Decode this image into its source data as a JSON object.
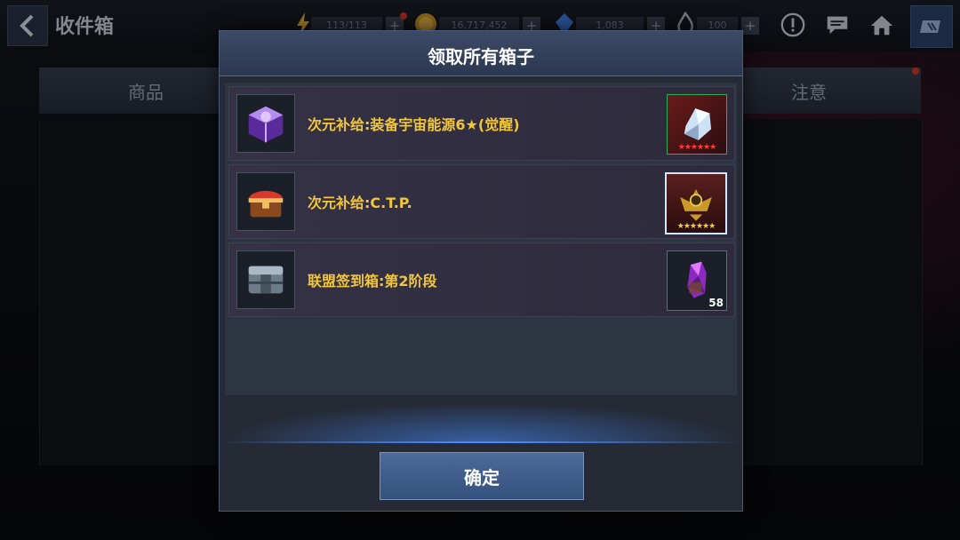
{
  "header": {
    "title": "收件箱",
    "resources": [
      {
        "icon": "energy-icon",
        "value": "113/113"
      },
      {
        "icon": "gold-coin-icon",
        "value": "16,717,452"
      },
      {
        "icon": "crystal-icon",
        "value": "1,083"
      },
      {
        "icon": "stamina-flame-icon",
        "value": "100"
      }
    ]
  },
  "tabs": {
    "left": "商品",
    "right": "注意"
  },
  "dialog": {
    "title": "领取所有箱子",
    "items": [
      {
        "label": "次元补给:装备宇宙能源6★(觉醒)",
        "box_icon": "purple-box-icon",
        "reward_icon": "crystal-shard-icon",
        "reward_stars": "★★★★★★"
      },
      {
        "label": "次元补给:C.T.P.",
        "box_icon": "red-chest-icon",
        "reward_icon": "gold-emblem-icon",
        "reward_stars": "★★★★★★"
      },
      {
        "label": "联盟签到箱:第2阶段",
        "box_icon": "metal-crate-icon",
        "reward_icon": "purple-gem-icon",
        "reward_count": "58"
      }
    ],
    "confirm_label": "确定"
  },
  "colors": {
    "item_text": "#f1c63c",
    "accent_blue": "#4a8cff"
  }
}
